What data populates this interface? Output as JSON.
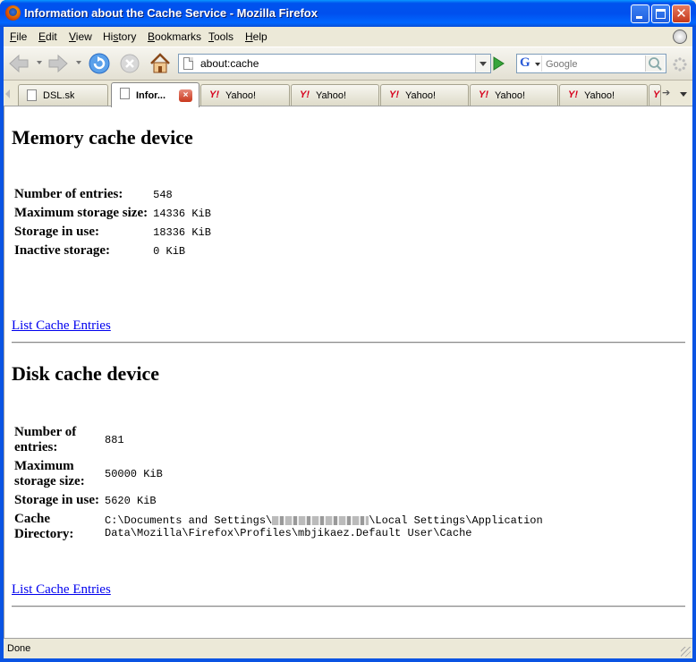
{
  "window": {
    "title": "Information about the Cache Service - Mozilla Firefox",
    "close_glyph": "✕"
  },
  "menubar": {
    "items": [
      {
        "key": "F",
        "rest": "ile"
      },
      {
        "key": "E",
        "rest": "dit"
      },
      {
        "key": "V",
        "rest": "iew"
      },
      {
        "key": "",
        "pre": "Hi",
        "keymid": "s",
        "rest": "tory"
      },
      {
        "key": "B",
        "rest": "ookmarks"
      },
      {
        "key": "T",
        "rest": "ools"
      },
      {
        "key": "H",
        "rest": "elp"
      }
    ]
  },
  "navbar": {
    "url": "about:cache",
    "search_placeholder": "Google",
    "search_engine_letter": "G"
  },
  "tabs": [
    {
      "label": "DSL.sk",
      "icon": "page-icon",
      "active": false
    },
    {
      "label": "Infor...",
      "icon": "page-icon",
      "active": true,
      "close": "×"
    },
    {
      "label": "Yahoo!",
      "icon": "yahoo-icon",
      "logo": "Y!",
      "active": false
    },
    {
      "label": "Yahoo!",
      "icon": "yahoo-icon",
      "logo": "Y!",
      "active": false
    },
    {
      "label": "Yahoo!",
      "icon": "yahoo-icon",
      "logo": "Y!",
      "active": false
    },
    {
      "label": "Yahoo!",
      "icon": "yahoo-icon",
      "logo": "Y!",
      "active": false
    },
    {
      "label": "Yahoo!",
      "icon": "yahoo-icon",
      "logo": "Y!",
      "active": false
    },
    {
      "label": "",
      "icon": "yahoo-icon",
      "logo": "Y",
      "active": false
    }
  ],
  "tab_scroll_glyph": "➔",
  "memory": {
    "heading": "Memory cache device",
    "rows": [
      {
        "label": "Number of entries:",
        "value": "548"
      },
      {
        "label": "Maximum storage size:",
        "value": "14336 KiB"
      },
      {
        "label": "Storage in use:",
        "value": "18336 KiB"
      },
      {
        "label": "Inactive storage:",
        "value": "0 KiB"
      }
    ],
    "link": "List Cache Entries"
  },
  "disk": {
    "heading": "Disk cache device",
    "rows": [
      {
        "label_l1": "Number of",
        "label_l2": "entries:",
        "value": "881"
      },
      {
        "label_l1": "Maximum",
        "label_l2": "storage size:",
        "value": "50000 KiB"
      },
      {
        "label_l1": "Storage in use:",
        "label_l2": "",
        "value": "5620 KiB"
      }
    ],
    "dir": {
      "label_l1": "Cache",
      "label_l2": "Directory:",
      "value_l1_pre": "C:\\Documents and Settings\\",
      "value_l1_post": "\\Local Settings\\Application",
      "value_l2": "Data\\Mozilla\\Firefox\\Profiles\\mbjikaez.Default User\\Cache"
    },
    "link": "List Cache Entries"
  },
  "status": {
    "text": "Done"
  },
  "colors": {
    "titlebar": "#0053ee",
    "link": "#0000ee",
    "chrome": "#ece9d8"
  }
}
